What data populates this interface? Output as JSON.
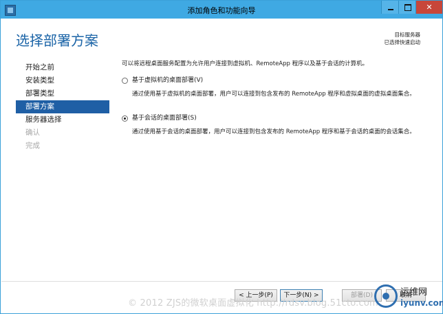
{
  "window": {
    "title": "添加角色和功能向导",
    "controls": {
      "minimize": "",
      "maximize": "",
      "close": "✕"
    }
  },
  "header": {
    "heading": "选择部署方案",
    "server_label": "目标服务器",
    "server_value": "已选择快速启动"
  },
  "sidebar": {
    "items": [
      {
        "label": "开始之前",
        "state": "normal"
      },
      {
        "label": "安装类型",
        "state": "normal"
      },
      {
        "label": "部署类型",
        "state": "normal"
      },
      {
        "label": "部署方案",
        "state": "active"
      },
      {
        "label": "服务器选择",
        "state": "normal"
      },
      {
        "label": "确认",
        "state": "disabled"
      },
      {
        "label": "完成",
        "state": "disabled"
      }
    ]
  },
  "main": {
    "intro": "可以将远程桌面服务配置为允许用户连接到虚拟机、RemoteApp 程序以及基于会话的计算机。",
    "options": [
      {
        "label": "基于虚拟机的桌面部署(V)",
        "selected": false,
        "description": "通过使用基于虚拟机的桌面部署，用户可以连接到包含发布的 RemoteApp 程序和虚拟桌面的虚拟桌面集合。"
      },
      {
        "label": "基于会话的桌面部署(S)",
        "selected": true,
        "description": "通过使用基于会话的桌面部署，用户可以连接到包含发布的 RemoteApp 程序和基于会话的桌面的会话集合。"
      }
    ]
  },
  "footer": {
    "prev": "< 上一步(P)",
    "next": "下一步(N) >",
    "deploy": "部署(D)",
    "cancel": "取消"
  },
  "watermark": {
    "text": "© 2012 ZJS的微软桌面虚拟化 http://rdsv.blog.51cto.com",
    "logo_cn": "运维网",
    "logo_en": "iyunv.com"
  },
  "colors": {
    "titlebar": "#3fa9e3",
    "heading": "#1b64a7",
    "active_nav": "#1f5fa5",
    "close": "#c7463a"
  }
}
